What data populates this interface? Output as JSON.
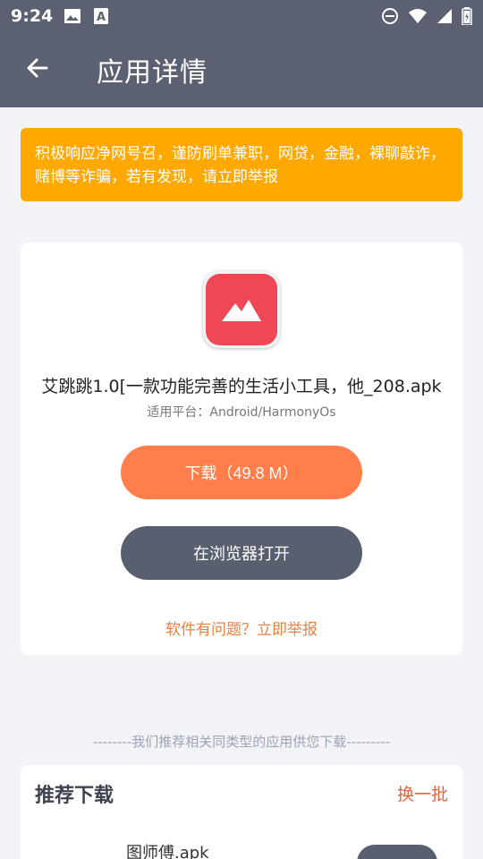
{
  "status_bar": {
    "time": "9:24",
    "left_icons": [
      "image-icon",
      "a-font-icon"
    ],
    "right_icons": [
      "do-not-disturb-icon",
      "wifi-icon",
      "signal-icon",
      "battery-icon"
    ]
  },
  "app_bar": {
    "title": "应用详情",
    "back_icon": "arrow-left-icon"
  },
  "notice": {
    "text": "积极响应净网号召，谨防刷单兼职，网贷，金融，裸聊敲诈，赌博等诈骗，若有发现，请立即举报"
  },
  "app": {
    "icon": "image-placeholder-icon",
    "name": "艾跳跳1.0[一款功能完善的生活小工具，他_208.apk",
    "platform": "适用平台：Android/HarmonyOs",
    "download_label": "下载（49.8 M）",
    "browser_label": "在浏览器打开",
    "report_label": "软件有问题？立即举报"
  },
  "recommend": {
    "divider_text": "--------我们推荐相关同类型的应用供您下载---------",
    "title": "推荐下载",
    "refresh_label": "换一批",
    "items": [
      {
        "name": "图师傅.apk"
      }
    ]
  },
  "colors": {
    "header": "#5b6170",
    "notice": "#ffa800",
    "download": "#ff7e4b",
    "browser": "#585f6e",
    "report": "#e8823f",
    "app_icon": "#ef4756"
  }
}
